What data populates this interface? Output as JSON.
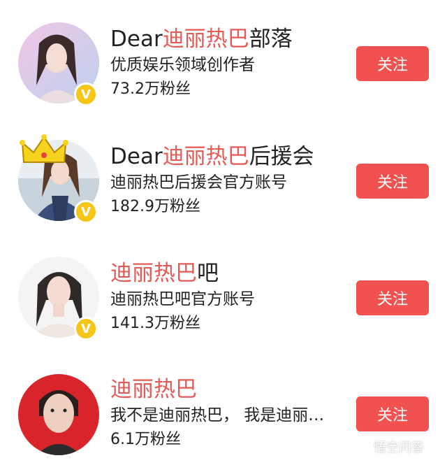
{
  "accounts": [
    {
      "name_prefix": "Dear",
      "name_highlight": "迪丽热巴",
      "name_suffix": "部落",
      "description": "优质娱乐领域创作者",
      "fans": "73.2万粉丝",
      "verified_badge": "V",
      "follow_label": "关注"
    },
    {
      "name_prefix": "Dear",
      "name_highlight": "迪丽热巴",
      "name_suffix": "后援会",
      "description": "迪丽热巴后援会官方账号",
      "fans": "182.9万粉丝",
      "verified_badge": "V",
      "follow_label": "关注"
    },
    {
      "name_prefix": "",
      "name_highlight": "迪丽热巴",
      "name_suffix": "吧",
      "description": "迪丽热巴吧官方账号",
      "fans": "141.3万粉丝",
      "verified_badge": "V",
      "follow_label": "关注"
    },
    {
      "name_prefix": "",
      "name_highlight": "迪丽热巴",
      "name_suffix": "",
      "description": "我不是迪丽热巴， 我是迪丽…",
      "fans": "6.1万粉丝",
      "follow_label": "关注"
    }
  ],
  "watermark": {
    "text": "悟空问答",
    "icon": "wukong-logo-icon"
  },
  "colors": {
    "highlight": "#e65a55",
    "follow_button": "#f2524f",
    "badge": "#f5c518"
  }
}
